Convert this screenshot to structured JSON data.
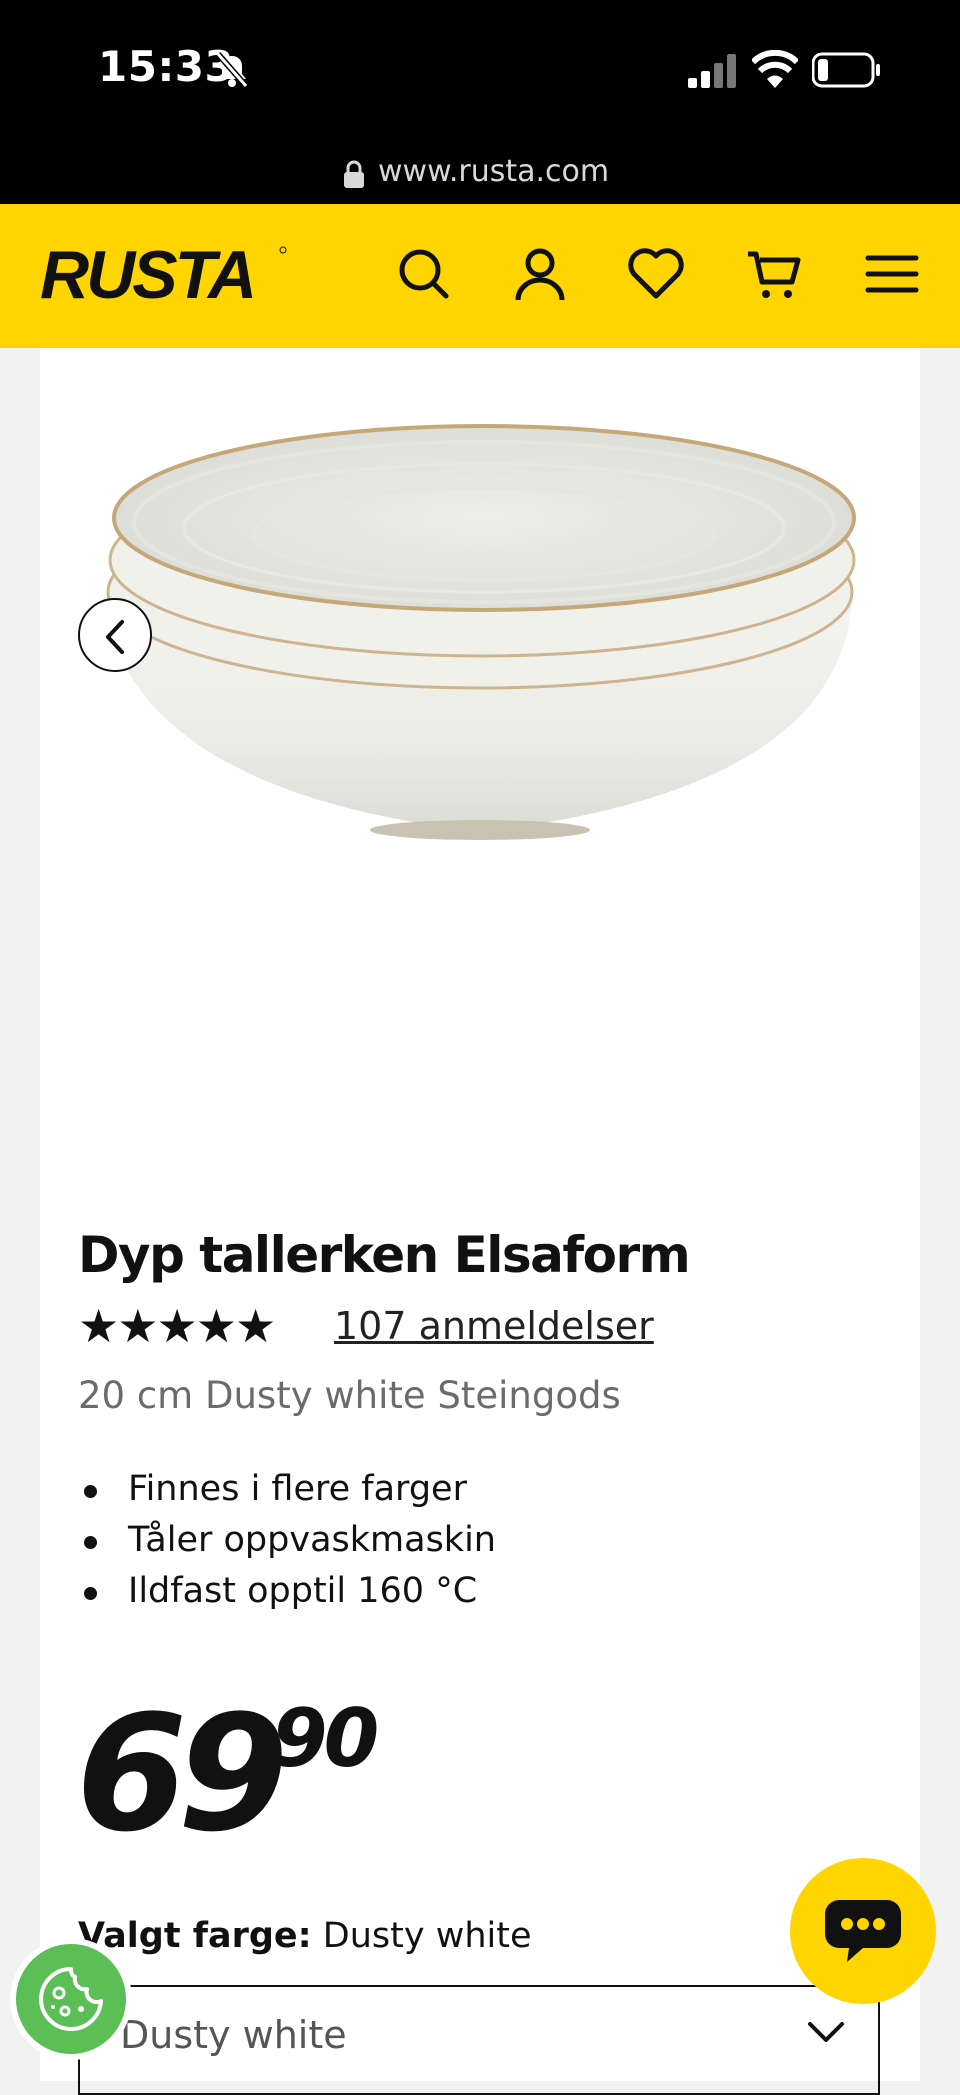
{
  "status_bar": {
    "time": "15:33"
  },
  "browser": {
    "url": "www.rusta.com"
  },
  "header": {
    "logo_text": "RUSTA",
    "icons": [
      "search-icon",
      "account-icon",
      "heart-icon",
      "cart-icon",
      "menu-icon"
    ],
    "background_color": "#ffd500"
  },
  "product": {
    "title": "Dyp tallerken Elsaform",
    "rating_stars": "★★★★★",
    "rating": 5,
    "reviews_label": "107 anmeldelser",
    "subtitle": "20 cm Dusty white Steingods",
    "features": [
      "Finnes i flere farger",
      "Tåler oppvaskmaskin",
      "Ildfast opptil 160 °C"
    ],
    "price_integer": "69",
    "price_decimal": "90",
    "selected_color_label": "Valgt farge:",
    "selected_color_value": "Dusty white",
    "color_select_value": "Dusty white"
  },
  "colors": {
    "accent": "#ffd500",
    "cookie": "#5cbf56"
  }
}
